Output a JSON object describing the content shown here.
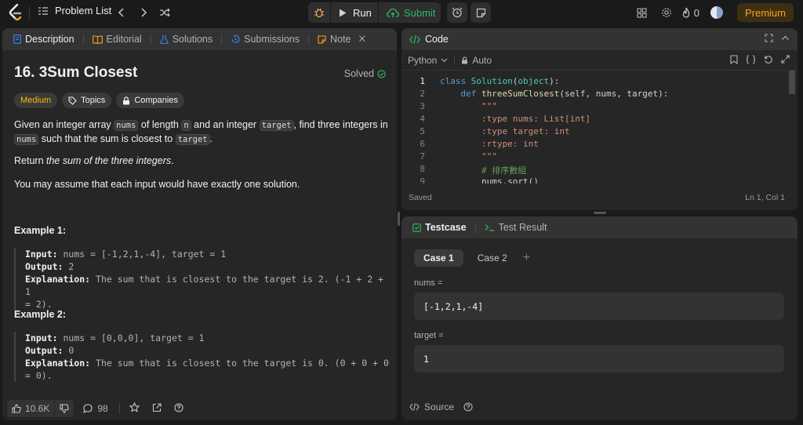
{
  "topbar": {
    "problem_list_label": "Problem List",
    "run_label": "Run",
    "submit_label": "Submit",
    "streak_count": "0",
    "premium_label": "Premium"
  },
  "description_panel": {
    "tabs": [
      {
        "label": "Description",
        "icon": "description-icon"
      },
      {
        "label": "Editorial",
        "icon": "book-icon"
      },
      {
        "label": "Solutions",
        "icon": "flask-icon"
      },
      {
        "label": "Submissions",
        "icon": "history-icon"
      },
      {
        "label": "Note",
        "icon": "note-icon"
      }
    ],
    "title": "16. 3Sum Closest",
    "status": "Solved",
    "chips": {
      "difficulty": "Medium",
      "topics": "Topics",
      "companies": "Companies"
    },
    "statement": {
      "p1_a": "Given an integer array ",
      "p1_code1": "nums",
      "p1_b": " of length ",
      "p1_code2": "n",
      "p1_c": " and an integer ",
      "p1_code3": "target",
      "p1_d": ", find three integers in ",
      "p1_code4": "nums",
      "p1_e": " such that the sum is closest to ",
      "p1_code5": "target",
      "p1_f": ".",
      "p2_a": "Return ",
      "p2_em": "the sum of the three integers",
      "p2_b": ".",
      "p3": "You may assume that each input would have exactly one solution."
    },
    "examples": [
      {
        "heading": "Example 1:",
        "input_label": "Input:",
        "input": " nums = [-1,2,1,-4], target = 1",
        "output_label": "Output:",
        "output": " 2",
        "explanation_label": "Explanation:",
        "explanation_l1": " The sum that is closest to the target is 2. (-1 + 2 + 1",
        "explanation_l2": "= 2)."
      },
      {
        "heading": "Example 2:",
        "input_label": "Input:",
        "input": " nums = [0,0,0], target = 1",
        "output_label": "Output:",
        "output": " 0",
        "explanation_label": "Explanation:",
        "explanation_l1": " The sum that is closest to the target is 0. (0 + 0 + 0",
        "explanation_l2": "= 0)."
      }
    ],
    "footer": {
      "likes": "10.6K",
      "comments": "98"
    }
  },
  "code_panel": {
    "title": "Code",
    "language": "Python",
    "autocomplete": "Auto",
    "line_numbers": [
      "1",
      "2",
      "3",
      "4",
      "5",
      "6",
      "7",
      "8",
      "9"
    ],
    "status": "Saved",
    "cursor": "Ln 1, Col 1"
  },
  "testcase_panel": {
    "tabs": [
      {
        "label": "Testcase"
      },
      {
        "label": "Test Result"
      }
    ],
    "cases": [
      "Case 1",
      "Case 2"
    ],
    "fields": [
      {
        "label": "nums =",
        "value": "[-1,2,1,-4]"
      },
      {
        "label": "target =",
        "value": "1"
      }
    ],
    "source_label": "Source"
  }
}
